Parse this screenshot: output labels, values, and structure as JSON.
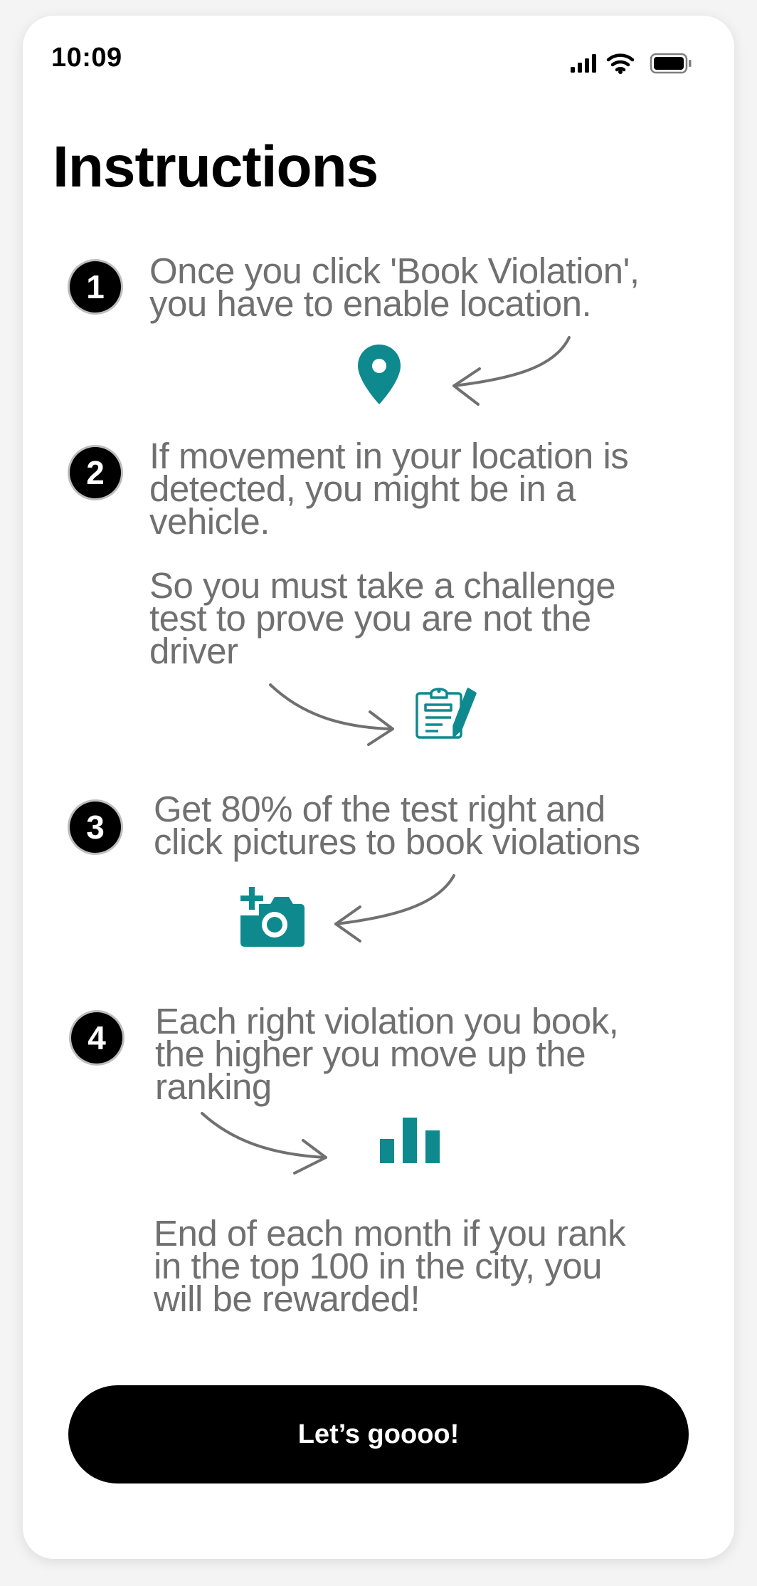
{
  "status": {
    "time": "10:09"
  },
  "page": {
    "title": "Instructions"
  },
  "steps": [
    {
      "number": "1",
      "text": [
        "Once you click 'Book Violation',",
        "you have to enable location."
      ],
      "icon": "location-pin-icon"
    },
    {
      "number": "2",
      "text": [
        "If movement in your location is",
        "detected, you might be in a",
        "vehicle."
      ],
      "extra": [
        "So you must take a challenge",
        "test to prove you are not the",
        "driver"
      ],
      "icon": "clipboard-edit-icon"
    },
    {
      "number": "3",
      "text": [
        "Get 80% of the test right and",
        "click pictures to book violations"
      ],
      "icon": "add-camera-icon"
    },
    {
      "number": "4",
      "text": [
        "Each right violation you book,",
        "the higher you move up the",
        "ranking"
      ],
      "icon": "bar-chart-icon"
    }
  ],
  "footer_note": [
    "End of each month if you rank",
    "in the top 100 in the city, you",
    "will be rewarded!"
  ],
  "cta": {
    "label": "Let’s goooo!"
  },
  "colors": {
    "accent": "#0e8a8f",
    "text": "#707070",
    "arrow": "#707070"
  }
}
